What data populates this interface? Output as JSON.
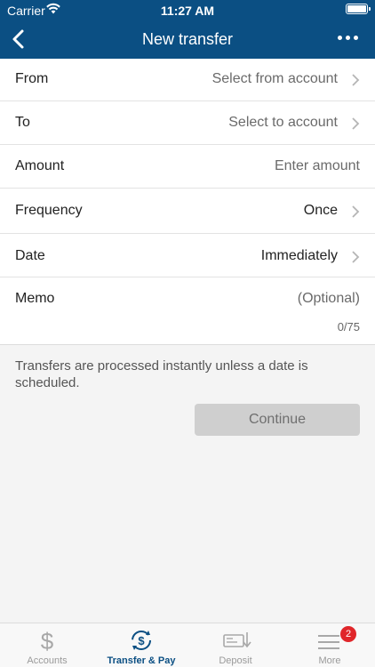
{
  "status_bar": {
    "carrier": "Carrier",
    "time": "11:27 AM"
  },
  "nav": {
    "title": "New transfer",
    "back_icon": "chevron-left-icon",
    "more_icon": "more-dots-icon"
  },
  "form": {
    "from": {
      "label": "From",
      "value": "Select from account"
    },
    "to": {
      "label": "To",
      "value": "Select to account"
    },
    "amount": {
      "label": "Amount",
      "placeholder": "Enter amount"
    },
    "frequency": {
      "label": "Frequency",
      "value": "Once"
    },
    "date": {
      "label": "Date",
      "value": "Immediately"
    },
    "memo": {
      "label": "Memo",
      "placeholder": "(Optional)",
      "counter": "0/75"
    }
  },
  "info": {
    "message": "Transfers are processed instantly unless a date is scheduled.",
    "continue_label": "Continue"
  },
  "tabbar": {
    "items": [
      {
        "label": "Accounts",
        "icon": "dollar-icon"
      },
      {
        "label": "Transfer & Pay",
        "icon": "transfer-pay-icon",
        "active": true
      },
      {
        "label": "Deposit",
        "icon": "check-deposit-icon"
      },
      {
        "label": "More",
        "icon": "menu-icon",
        "badge": "2"
      }
    ]
  },
  "colors": {
    "primary": "#0b4f83",
    "badge": "#e0262a",
    "button_disabled": "#cfcfcf"
  }
}
